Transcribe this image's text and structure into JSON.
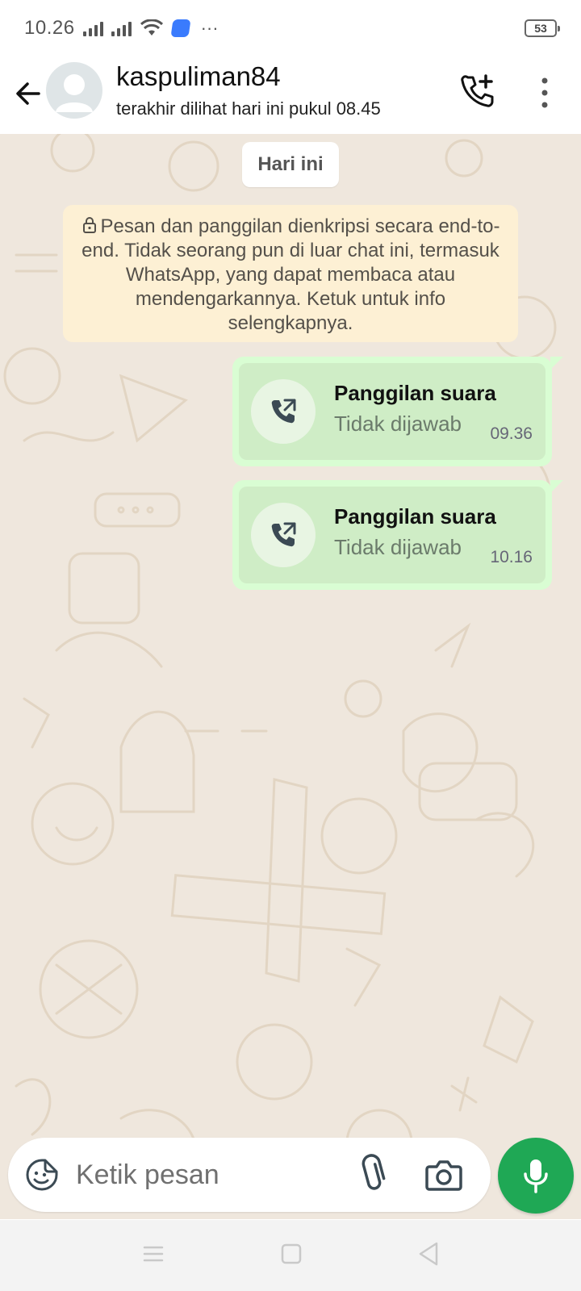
{
  "status_bar": {
    "time": "10.26",
    "battery": "53",
    "more": "···"
  },
  "header": {
    "contact_name": "kaspuliman84",
    "last_seen": "terakhir dilihat hari ini pukul 08.45"
  },
  "chat": {
    "date_chip": "Hari ini",
    "e2e_notice": "Pesan dan panggilan dienkripsi secara end-to-end. Tidak seorang pun di luar chat ini, termasuk WhatsApp, yang dapat membaca atau mendengarkannya. Ketuk untuk info selengkapnya.",
    "messages": [
      {
        "title": "Panggilan suara",
        "status": "Tidak dijawab",
        "time": "09.36"
      },
      {
        "title": "Panggilan suara",
        "status": "Tidak dijawab",
        "time": "10.16"
      }
    ]
  },
  "composer": {
    "placeholder": "Ketik pesan"
  },
  "icons": {
    "back": "arrow-left-icon",
    "avatar": "default-avatar-icon",
    "add_call": "phone-plus-icon",
    "menu": "more-vertical-icon",
    "outgoing_call": "phone-outgoing-icon",
    "emoji": "sticker-icon",
    "attach": "paperclip-icon",
    "camera": "camera-icon",
    "mic": "microphone-icon"
  },
  "colors": {
    "accent_green": "#1fa855",
    "bubble_out": "#d9fdd3",
    "notice_bg": "#fdf0d4",
    "chat_bg": "#efe7dd"
  }
}
